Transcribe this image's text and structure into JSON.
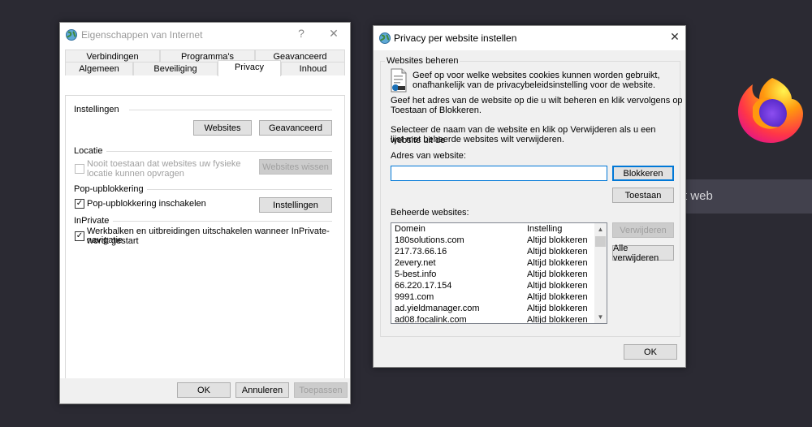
{
  "background": {
    "search_text": "t web",
    "browser_icon": "firefox-logo"
  },
  "left_dialog": {
    "title": "Eigenschappen van Internet",
    "help_label": "?",
    "close_label": "✕",
    "tabs_row1": [
      "Verbindingen",
      "Programma's",
      "Geavanceerd"
    ],
    "tabs_row2": [
      "Algemeen",
      "Beveiliging",
      "Privacy",
      "Inhoud"
    ],
    "active_tab": "Privacy",
    "settings": {
      "group": "Instellingen",
      "websites_button": "Websites",
      "advanced_button": "Geavanceerd"
    },
    "location": {
      "group": "Locatie",
      "checkbox_label_line1": "Nooit toestaan dat websites uw fysieke",
      "checkbox_label_line2": "locatie kunnen opvragen",
      "checked": false,
      "clear_sites_button": "Websites wissen"
    },
    "popup": {
      "group": "Pop-upblokkering",
      "checkbox_label": "Pop-upblokkering inschakelen",
      "checked": true,
      "settings_button": "Instellingen"
    },
    "inprivate": {
      "group": "InPrivate",
      "checkbox_label_line1": "Werkbalken en uitbreidingen uitschakelen wanneer InPrivate-navigatie",
      "checkbox_label_line2": "wordt gestart",
      "checked": true
    },
    "footer": {
      "ok": "OK",
      "cancel": "Annuleren",
      "apply": "Toepassen"
    }
  },
  "right_dialog": {
    "title": "Privacy per website instellen",
    "close_label": "✕",
    "group": "Websites beheren",
    "intro_line1": "Geef op voor welke websites cookies kunnen worden gebruikt,",
    "intro_line2": "onafhankelijk van de privacybeleidsinstelling voor de website.",
    "instr1_line1": "Geef het adres van de website op die u wilt beheren en klik vervolgens op",
    "instr1_line2": "Toestaan of Blokkeren.",
    "instr2_line1": "Selecteer de naam van de website en klik op Verwijderen als u een website uit de",
    "instr2_line2": "lijst met beheerde websites wilt verwijderen.",
    "address_label": "Adres van website:",
    "address_value": "",
    "block_button": "Blokkeren",
    "allow_button": "Toestaan",
    "managed_label": "Beheerde websites:",
    "remove_button": "Verwijderen",
    "remove_all_button": "Alle verwijderen",
    "ok_button": "OK",
    "columns": [
      "Domein",
      "Instelling"
    ],
    "rows": [
      [
        "180solutions.com",
        "Altijd blokkeren"
      ],
      [
        "217.73.66.16",
        "Altijd blokkeren"
      ],
      [
        "2every.net",
        "Altijd blokkeren"
      ],
      [
        "5-best.info",
        "Altijd blokkeren"
      ],
      [
        "66.220.17.154",
        "Altijd blokkeren"
      ],
      [
        "9991.com",
        "Altijd blokkeren"
      ],
      [
        "ad.yieldmanager.com",
        "Altijd blokkeren"
      ],
      [
        "ad08.focalink.com",
        "Altijd blokkeren"
      ]
    ]
  }
}
